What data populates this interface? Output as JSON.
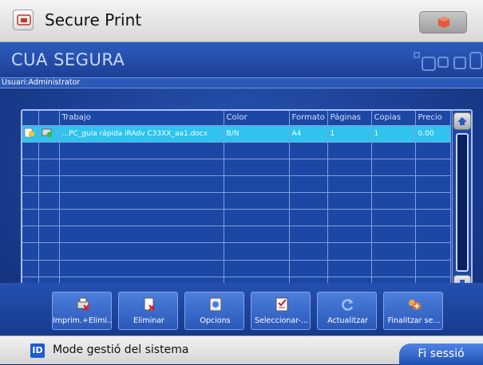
{
  "app": {
    "title": "Secure Print"
  },
  "header": {
    "title": "CUA SEGURA"
  },
  "user": {
    "label": "Usuari:Administrator"
  },
  "table": {
    "columns": [
      "Trabajo",
      "Color",
      "Formato",
      "Páginas",
      "Copias",
      "Precio"
    ],
    "rows": [
      {
        "trabajo": "...PC_guia rápida iRAdv C33XX_aa1.docx",
        "color": "B/N",
        "formato": "A4",
        "paginas": "1",
        "copias": "1",
        "precio": "0.00",
        "selected": true
      }
    ]
  },
  "actions": [
    {
      "label": "Imprim.+Elimi...",
      "icon": "print-delete-icon"
    },
    {
      "label": "Eliminar",
      "icon": "delete-icon"
    },
    {
      "label": "Opcions",
      "icon": "options-icon"
    },
    {
      "label": "Seleccionar-...",
      "icon": "select-all-icon"
    },
    {
      "label": "Actualitzar",
      "icon": "refresh-icon"
    },
    {
      "label": "Finalitzar se...",
      "icon": "finish-session-icon"
    }
  ],
  "status": {
    "badge": "ID",
    "text": "Mode gestió del sistema",
    "logout_label": "Fi sessió"
  },
  "colors": {
    "header": "#1c3f96",
    "selected_row": "#2fc3ee",
    "background": "#0f2e6e"
  }
}
